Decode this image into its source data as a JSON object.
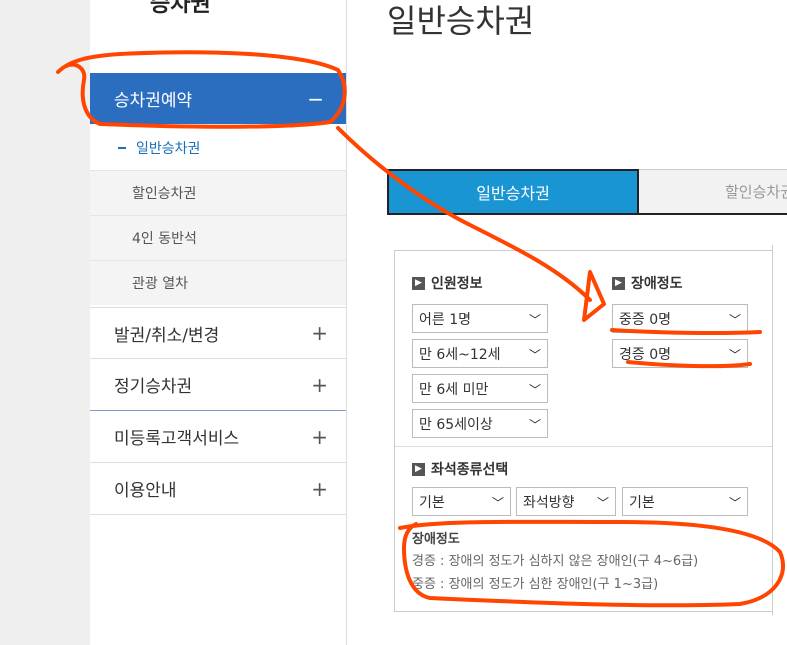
{
  "page_title": "일반승차권",
  "sidebar": {
    "top_title": "승차권",
    "active_menu": {
      "label": "승차권예약",
      "toggle": "−"
    },
    "sub_items": [
      {
        "label": "일반승차권"
      },
      {
        "label": "할인승차권"
      },
      {
        "label": "4인 동반석"
      },
      {
        "label": "관광 열차"
      }
    ],
    "menus": [
      {
        "label": "발권/취소/변경",
        "toggle": "+"
      },
      {
        "label": "정기승차권",
        "toggle": "+"
      },
      {
        "label": "미등록고객서비스",
        "toggle": "+"
      },
      {
        "label": "이용안내",
        "toggle": "+"
      }
    ]
  },
  "tabs": [
    {
      "label": "일반승차권"
    },
    {
      "label": "할인승차권"
    }
  ],
  "passenger_info": {
    "title": "인원정보",
    "selects": [
      "어른 1명",
      "만 6세~12세",
      "만 6세 미만",
      "만 65세이상"
    ]
  },
  "disability": {
    "title": "장애정도",
    "selects": [
      "중증 0명",
      "경증 0명"
    ]
  },
  "seat_type": {
    "title": "좌석종류선택",
    "selects": [
      "기본",
      "좌석방향",
      "기본"
    ]
  },
  "note": {
    "title": "장애정도",
    "lines": [
      "경증 : 장애의 정도가 심하지 않은 장애인(구 4~6급)",
      "중증 : 장애의 정도가 심한 장애인(구 1~3급)"
    ]
  },
  "colors": {
    "accent_blue": "#2b6ec0",
    "tab_blue": "#1a95d3",
    "annotation": "#ff4500"
  }
}
